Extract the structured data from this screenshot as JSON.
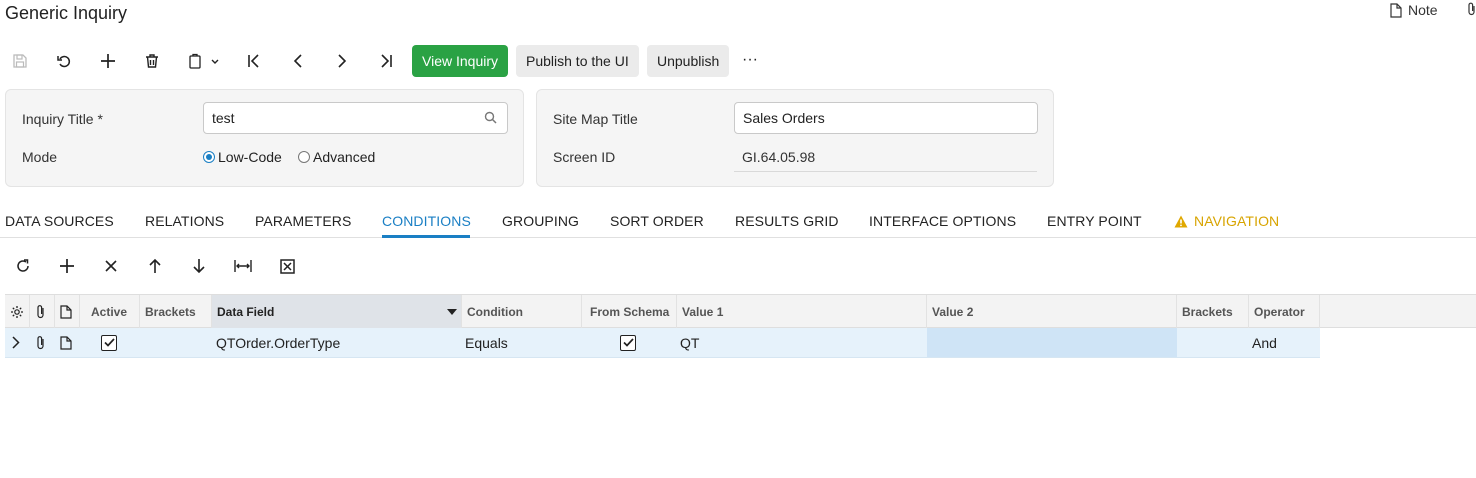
{
  "page": {
    "title": "Generic Inquiry",
    "note_label": "Note"
  },
  "toolbar": {
    "icons": [
      "save-icon",
      "undo-icon",
      "add-icon",
      "delete-icon",
      "copy-paste-icon",
      "first-record-icon",
      "previous-record-icon",
      "next-record-icon",
      "last-record-icon",
      "more-icon"
    ],
    "view_inquiry": "View Inquiry",
    "publish": "Publish to the UI",
    "unpublish": "Unpublish",
    "more": "···"
  },
  "form": {
    "inquiry_title_label": "Inquiry Title *",
    "inquiry_title_value": "test",
    "mode_label": "Mode",
    "mode_options": [
      "Low-Code",
      "Advanced"
    ],
    "mode_selected": "Low-Code",
    "site_map_title_label": "Site Map Title",
    "site_map_title_value": "Sales Orders",
    "screen_id_label": "Screen ID",
    "screen_id_value": "GI.64.05.98"
  },
  "tabs": [
    {
      "label": "DATA SOURCES"
    },
    {
      "label": "RELATIONS"
    },
    {
      "label": "PARAMETERS"
    },
    {
      "label": "CONDITIONS"
    },
    {
      "label": "GROUPING"
    },
    {
      "label": "SORT ORDER"
    },
    {
      "label": "RESULTS GRID"
    },
    {
      "label": "INTERFACE OPTIONS"
    },
    {
      "label": "ENTRY POINT"
    },
    {
      "label": "NAVIGATION"
    }
  ],
  "active_tab": "CONDITIONS",
  "warning_tab": "NAVIGATION",
  "grid_toolbar": {
    "icons": [
      "refresh-icon",
      "add-row-icon",
      "delete-row-icon",
      "move-up-icon",
      "move-down-icon",
      "fit-columns-icon",
      "export-excel-icon"
    ]
  },
  "grid": {
    "columns": [
      "Active",
      "Brackets",
      "Data Field",
      "Condition",
      "From Schema",
      "Value 1",
      "Value 2",
      "Brackets",
      "Operator"
    ],
    "sorted_column": "Data Field",
    "rows": [
      {
        "active": true,
        "brackets_open": "",
        "data_field": "QTOrder.OrderType",
        "condition": "Equals",
        "from_schema": true,
        "value1": "QT",
        "value2": "",
        "brackets_close": "",
        "operator": "And"
      }
    ]
  },
  "colors": {
    "primary_button": "#2aa244",
    "active_tab": "#1a7fc4",
    "warning": "#d8a400",
    "row_highlight": "#e6f2fb"
  }
}
